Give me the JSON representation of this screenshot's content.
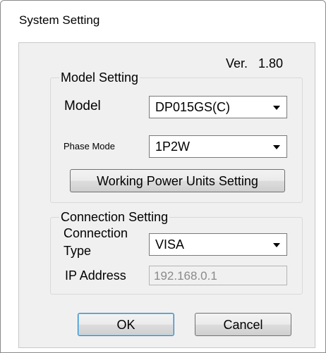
{
  "window": {
    "title": "System Setting"
  },
  "version": {
    "label": "Ver.",
    "value": "1.80"
  },
  "model_setting": {
    "group_title": "Model Setting",
    "model_label": "Model",
    "model_value": "DP015GS(C)",
    "phase_label": "Phase Mode",
    "phase_value": "1P2W",
    "working_units_button": "Working Power Units Setting"
  },
  "connection_setting": {
    "group_title": "Connection Setting",
    "type_label_line1": "Connection",
    "type_label_line2": "Type",
    "type_value": "VISA",
    "ip_label": "IP Address",
    "ip_value": "192.168.0.1"
  },
  "footer": {
    "ok_label": "OK",
    "cancel_label": "Cancel"
  },
  "icons": {
    "dropdown": "chevron-down-icon"
  }
}
